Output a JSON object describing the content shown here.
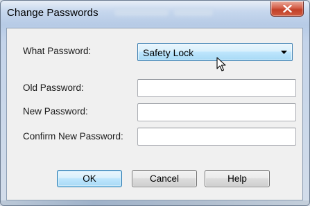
{
  "window": {
    "title": "Change Passwords"
  },
  "form": {
    "what_password_label": "What Password:",
    "what_password_value": "Safety Lock",
    "old_password_label": "Old Password:",
    "old_password_value": "",
    "new_password_label": "New Password:",
    "new_password_value": "",
    "confirm_password_label": "Confirm New Password:",
    "confirm_password_value": ""
  },
  "buttons": {
    "ok_label": "OK",
    "cancel_label": "Cancel",
    "help_label": "Help"
  },
  "icons": {
    "close": "close-icon",
    "dropdown": "chevron-down-icon",
    "cursor": "mouse-pointer-icon"
  },
  "colors": {
    "close_button": "#c24129",
    "focus_accent": "#3c7fb1",
    "client_background": "#f0f0f0"
  }
}
